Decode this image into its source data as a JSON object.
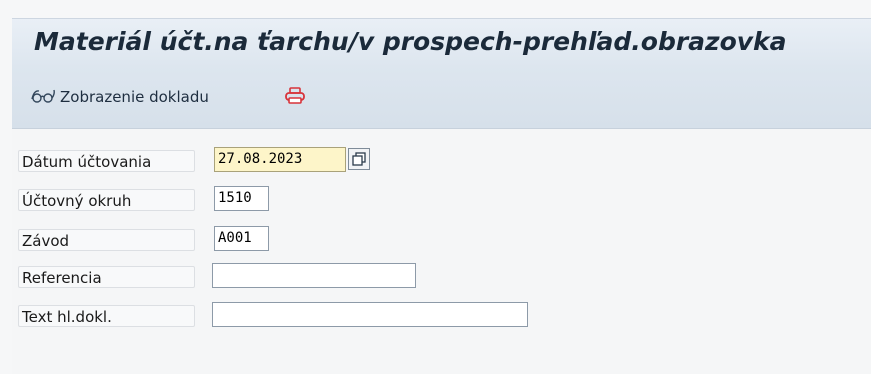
{
  "window": {
    "title": "Materiál účt.na ťarchu/v prospech-prehľad.obrazovka"
  },
  "toolbar": {
    "display_document_label": "Zobrazenie dokladu",
    "display_document_icon": "glasses-icon",
    "print_icon": "printer-icon"
  },
  "form": {
    "posting_date": {
      "label": "Dátum účtovania",
      "value": "27.08.2023"
    },
    "company_code": {
      "label": "Účtovný okruh",
      "value": "1510"
    },
    "plant": {
      "label": "Závod",
      "value": "A001"
    },
    "reference": {
      "label": "Referencia",
      "value": ""
    },
    "header_text": {
      "label": "Text hl.dokl.",
      "value": ""
    }
  },
  "colors": {
    "title_text": "#1b2a3a",
    "required_field": "#fdf5c9",
    "printer_icon": "#d8333a"
  }
}
